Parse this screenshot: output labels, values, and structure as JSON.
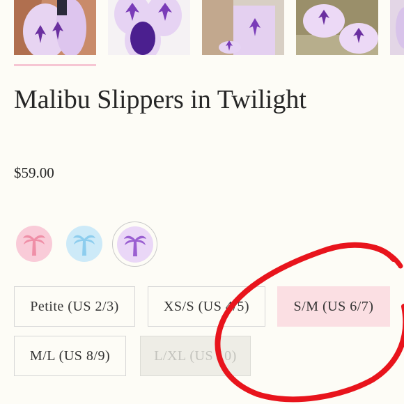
{
  "product": {
    "title": "Malibu Slippers in Twilight",
    "price": "$59.00"
  },
  "gallery": {
    "thumbnails": [
      {
        "name": "thumb-1"
      },
      {
        "name": "thumb-2"
      },
      {
        "name": "thumb-3"
      },
      {
        "name": "thumb-4"
      },
      {
        "name": "thumb-5"
      }
    ]
  },
  "colors": {
    "swatches": [
      {
        "name": "pink",
        "bg": "#f9cbd8",
        "icon": "#ef8fa7",
        "icon_name": "palm-tree-icon"
      },
      {
        "name": "blue",
        "bg": "#cdeaf8",
        "icon": "#8dcdee",
        "icon_name": "palm-tree-icon"
      },
      {
        "name": "purple",
        "bg": "#ead7f7",
        "icon": "#9a5fd1",
        "icon_name": "palm-tree-icon",
        "selected": true
      }
    ],
    "accent_pink": "#fbdfe3",
    "annotation_red": "#e8141c"
  },
  "sizes": [
    {
      "label": "Petite (US 2/3)",
      "state": "default"
    },
    {
      "label": "XS/S (US 4/5)",
      "state": "default"
    },
    {
      "label": "S/M (US 6/7)",
      "state": "selected"
    },
    {
      "label": "M/L (US 8/9)",
      "state": "default"
    },
    {
      "label": "L/XL (US 10)",
      "state": "disabled"
    }
  ]
}
